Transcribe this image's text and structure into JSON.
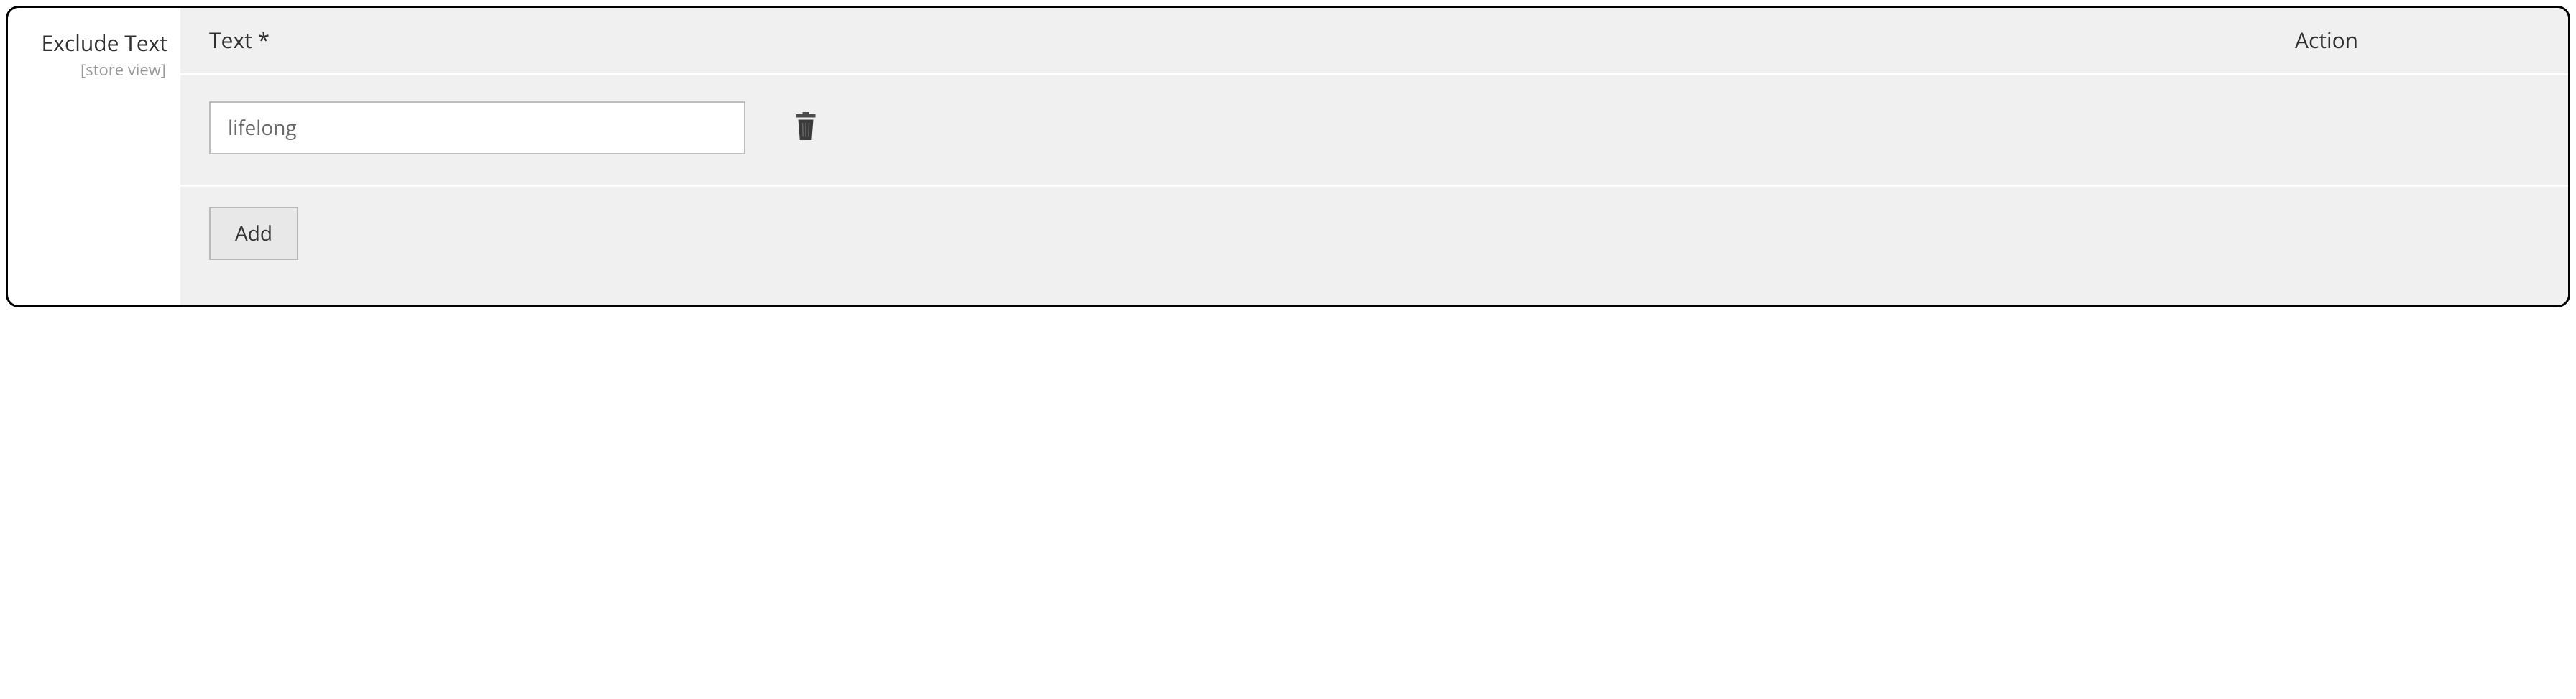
{
  "field": {
    "label": "Exclude Text",
    "scope": "[store view]"
  },
  "table": {
    "headers": {
      "text": "Text *",
      "action": "Action"
    },
    "rows": [
      {
        "value": "lifelong"
      }
    ]
  },
  "buttons": {
    "add": "Add"
  }
}
